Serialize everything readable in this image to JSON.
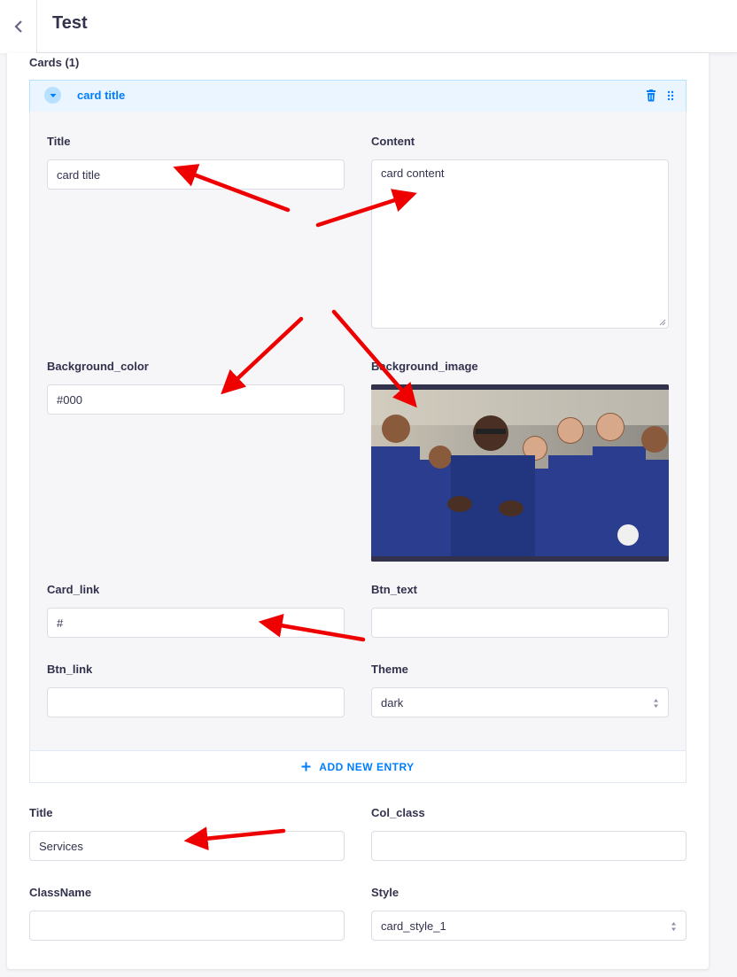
{
  "header": {
    "title": "Test"
  },
  "cards": {
    "label": "Cards (1)",
    "entry_title": "card title",
    "fields": {
      "title_label": "Title",
      "title_value": "card title",
      "content_label": "Content",
      "content_value": "card content",
      "background_color_label": "Background_color",
      "background_color_value": "#000",
      "background_image_label": "Background_image",
      "card_link_label": "Card_link",
      "card_link_value": "#",
      "btn_text_label": "Btn_text",
      "btn_text_value": "",
      "btn_link_label": "Btn_link",
      "btn_link_value": "",
      "theme_label": "Theme",
      "theme_value": "dark"
    },
    "add_entry_label": "ADD NEW ENTRY"
  },
  "section": {
    "title_label": "Title",
    "title_value": "Services",
    "col_class_label": "Col_class",
    "col_class_value": "",
    "classname_label": "ClassName",
    "classname_value": "",
    "style_label": "Style",
    "style_value": "card_style_1"
  },
  "icons": {
    "back": "chevron-left-icon",
    "collapse": "chevron-down-icon",
    "delete": "trash-icon",
    "drag": "drag-handle-icon",
    "add": "plus-icon"
  },
  "colors": {
    "accent": "#007eff",
    "annotation_arrow": "#ee0000"
  }
}
